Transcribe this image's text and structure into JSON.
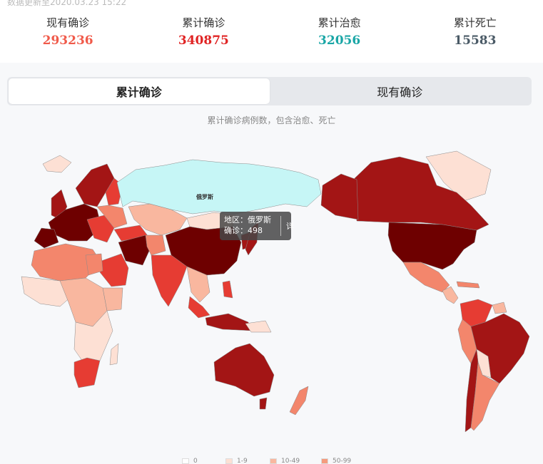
{
  "update_text": "数据更新至2020.03.23 15:22",
  "stats": [
    {
      "label": "现有确诊",
      "value": "293236",
      "color": "#f05a4a"
    },
    {
      "label": "累计确诊",
      "value": "340875",
      "color": "#e02424"
    },
    {
      "label": "累计治愈",
      "value": "32056",
      "color": "#1aa6a6"
    },
    {
      "label": "累计死亡",
      "value": "15583",
      "color": "#4a5a66"
    }
  ],
  "tabs": [
    {
      "label": "累计确诊",
      "active": true
    },
    {
      "label": "现有确诊",
      "active": false
    }
  ],
  "subtitle": "累计确诊病例数，包含治愈、死亡",
  "map": {
    "label": "俄罗斯",
    "tooltip": {
      "region": "地区：俄罗斯",
      "confirmed": "确诊：498",
      "detail": "详"
    }
  },
  "legend": [
    {
      "label": "0",
      "color": "#ffffff"
    },
    {
      "label": "1-9",
      "color": "#fde0d4"
    },
    {
      "label": "10-49",
      "color": "#f9b79f"
    },
    {
      "label": "50-99",
      "color": "#f59b7e"
    }
  ],
  "colors": {
    "scale": [
      "#ffffff",
      "#fde0d4",
      "#f9b79f",
      "#f3866c",
      "#e63c33",
      "#a31515",
      "#6e0000"
    ],
    "highlight": "#c6f6f6"
  }
}
